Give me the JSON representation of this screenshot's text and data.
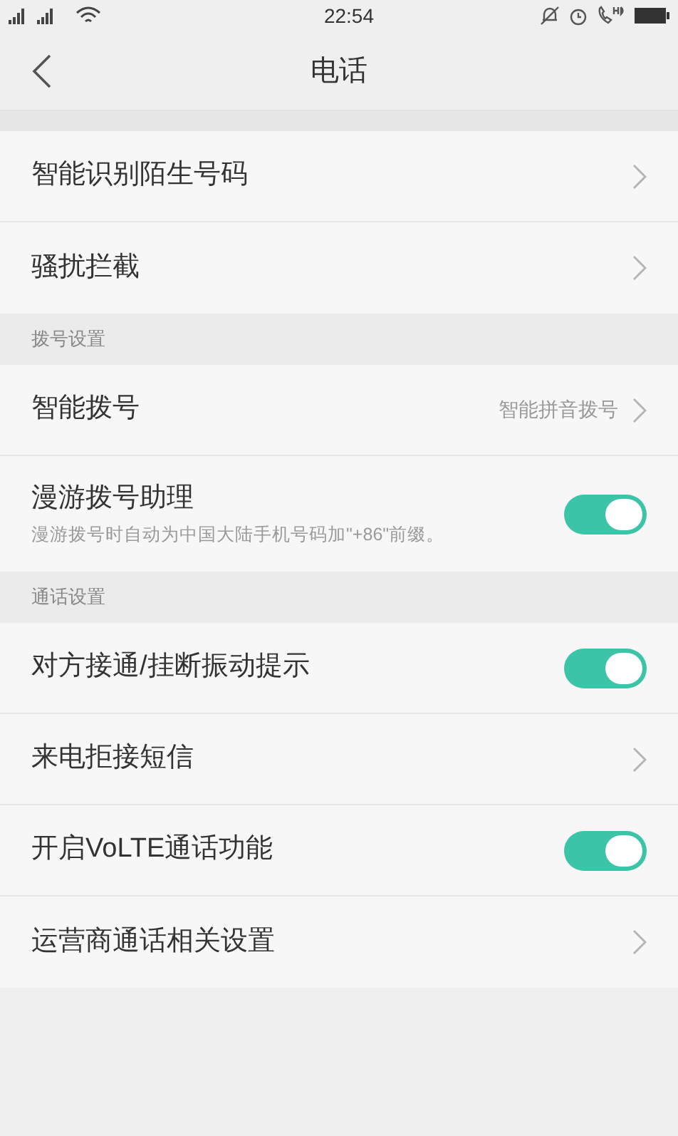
{
  "status_bar": {
    "time": "22:54"
  },
  "header": {
    "title": "电话"
  },
  "sections": [
    {
      "items": [
        {
          "kind": "link",
          "label": "智能识别陌生号码"
        },
        {
          "kind": "link",
          "label": "骚扰拦截"
        }
      ]
    },
    {
      "title": "拨号设置",
      "items": [
        {
          "kind": "link",
          "label": "智能拨号",
          "value": "智能拼音拨号"
        },
        {
          "kind": "toggle",
          "label": "漫游拨号助理",
          "description": "漫游拨号时自动为中国大陆手机号码加\"+86\"前缀。",
          "on": true
        }
      ]
    },
    {
      "title": "通话设置",
      "items": [
        {
          "kind": "toggle",
          "label": "对方接通/挂断振动提示",
          "on": true
        },
        {
          "kind": "link",
          "label": "来电拒接短信"
        },
        {
          "kind": "toggle",
          "label": "开启VoLTE通话功能",
          "on": true
        },
        {
          "kind": "link",
          "label": "运营商通话相关设置"
        }
      ]
    }
  ]
}
